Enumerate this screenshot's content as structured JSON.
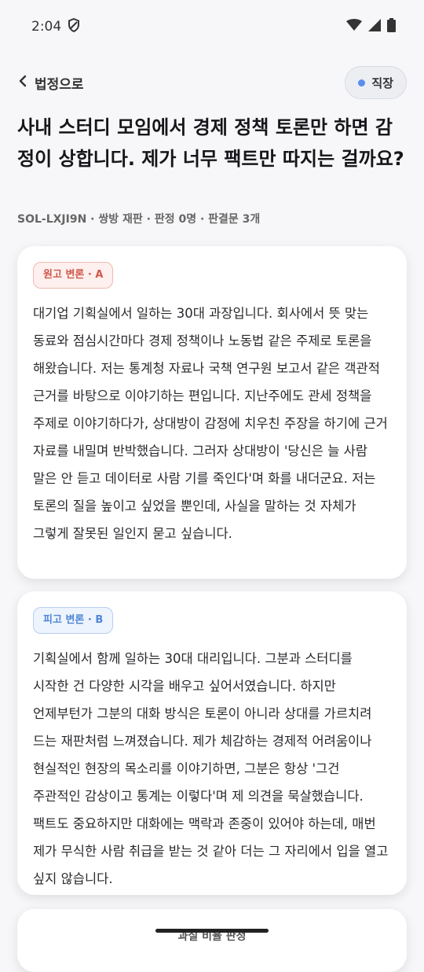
{
  "status": {
    "time": "2:04",
    "shield_icon": "shield-icon",
    "wifi_icon": "wifi-icon",
    "signal_icon": "signal-icon",
    "battery_icon": "battery-icon"
  },
  "topbar": {
    "back_label": "법정으로",
    "category_label": "직장",
    "category_dot_color": "#5b8def"
  },
  "post": {
    "title": "사내 스터디 모임에서 경제 정책 토론만 하면 감정이 상합니다. 제가 너무 팩트만 따지는 걸까요?",
    "meta": "SOL-LXJI9N · 쌍방 재판 · 판정 0명 · 판결문 3개"
  },
  "arguments": [
    {
      "badge": "원고 변론 · A",
      "text": "대기업 기획실에서 일하는 30대 과장입니다. 회사에서 뜻 맞는 동료와 점심시간마다 경제 정책이나 노동법 같은 주제로 토론을 해왔습니다. 저는 통계청 자료나 국책 연구원 보고서 같은 객관적 근거를 바탕으로 이야기하는 편입니다. 지난주에도 관세 정책을 주제로 이야기하다가, 상대방이 감정에 치우친 주장을 하기에 근거 자료를 내밀며 반박했습니다. 그러자 상대방이 '당신은 늘 사람 말은 안 듣고 데이터로 사람 기를 죽인다'며 화를 내더군요. 저는 토론의 질을 높이고 싶었을 뿐인데, 사실을 말하는 것 자체가 그렇게 잘못된 일인지 묻고 싶습니다."
    },
    {
      "badge": "피고 변론 · B",
      "text": "기획실에서 함께 일하는 30대 대리입니다. 그분과 스터디를 시작한 건 다양한 시각을 배우고 싶어서였습니다. 하지만 언제부턴가 그분의 대화 방식은 토론이 아니라 상대를 가르치려 드는 재판처럼 느껴졌습니다. 제가 체감하는 경제적 어려움이나 현실적인 현장의 목소리를 이야기하면, 그분은 항상 '그건 주관적인 감상이고 통계는 이렇다'며 제 의견을 묵살했습니다. 팩트도 중요하지만 대화에는 맥락과 존중이 있어야 하는데, 매번 제가 무식한 사람 취급을 받는 것 같아 더는 그 자리에서 입을 열고 싶지 않습니다."
    }
  ],
  "verdict_section": {
    "title": "과실 비율 판정"
  }
}
